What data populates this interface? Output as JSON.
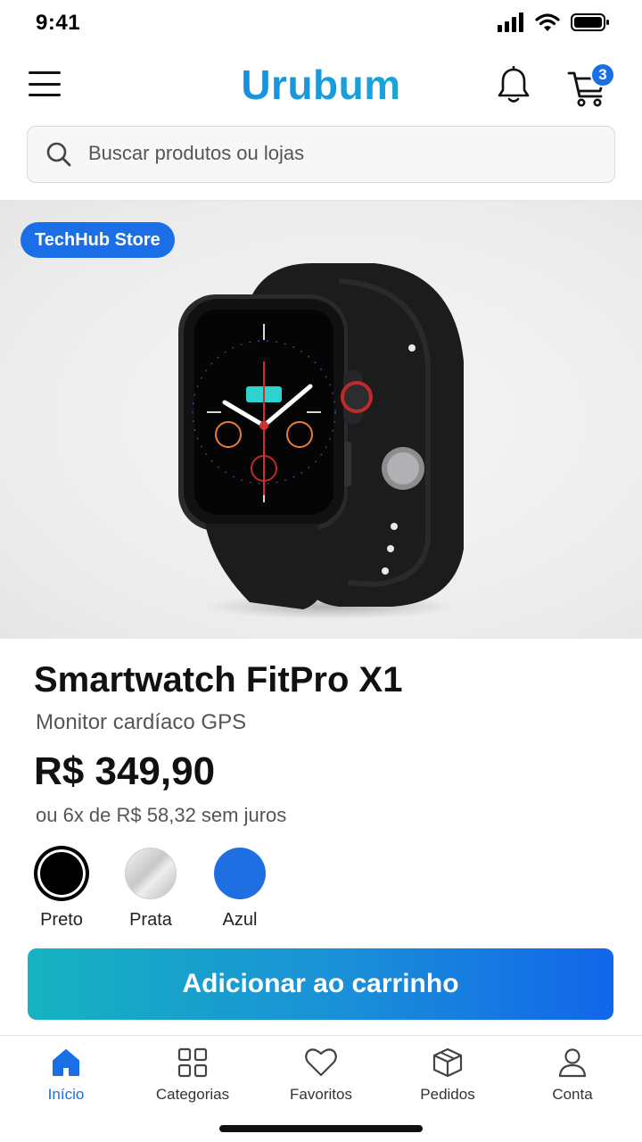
{
  "status_bar": {
    "time": "9:41"
  },
  "header": {
    "logo": "Urubum",
    "cart_count": "3"
  },
  "search": {
    "placeholder": "Buscar produtos ou lojas"
  },
  "product": {
    "store": "TechHub Store",
    "title": "Smartwatch FitPro X1",
    "subtitle": "Monitor cardíaco GPS",
    "price": "R$ 349,90",
    "installments": "ou 6x de R$ 58,32 sem juros",
    "colors": [
      {
        "label": "Preto",
        "hex": "#000000",
        "selected": true
      },
      {
        "label": "Prata",
        "hex": "#c8c8c8",
        "selected": false
      },
      {
        "label": "Azul",
        "hex": "#1f6fe3",
        "selected": false
      }
    ],
    "add_to_cart": "Adicionar ao carrinho"
  },
  "bottom_nav": {
    "items": [
      {
        "label": "Início",
        "icon": "home-icon",
        "active": true
      },
      {
        "label": "Categorias",
        "icon": "grid-icon",
        "active": false
      },
      {
        "label": "Favoritos",
        "icon": "heart-icon",
        "active": false
      },
      {
        "label": "Pedidos",
        "icon": "box-icon",
        "active": false
      },
      {
        "label": "Conta",
        "icon": "user-icon",
        "active": false
      }
    ]
  },
  "colors": {
    "accent": "#1a6fe6",
    "gradient_start": "#16b3c0",
    "gradient_end": "#1266ea"
  }
}
